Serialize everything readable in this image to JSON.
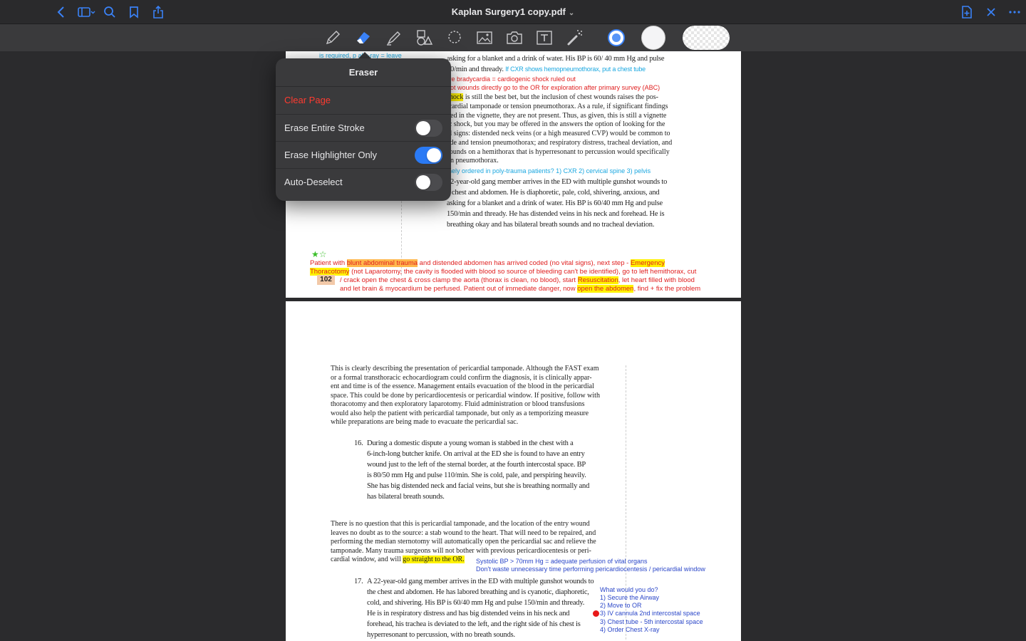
{
  "app": {
    "document_title": "Kaplan Surgery1 copy.pdf"
  },
  "colors": {
    "accent": "#3a82f7",
    "toggle_on": "#2a7af5",
    "danger": "#ff3b30",
    "pen_color_selected": "#3a82f7"
  },
  "topbar_icons": [
    "back-chevron-icon",
    "sidebar-icon",
    "search-icon",
    "bookmark-icon",
    "share-icon",
    "new-page-icon",
    "close-icon",
    "more-icon"
  ],
  "toolbar_tools": [
    "pen-icon",
    "eraser-icon",
    "highlighter-icon",
    "shapes-icon",
    "lasso-icon",
    "image-icon",
    "camera-icon",
    "text-box-icon",
    "laser-pointer-icon"
  ],
  "popover": {
    "title": "Eraser",
    "clear_page": "Clear Page",
    "rows": [
      {
        "label": "Erase Entire Stroke",
        "on": false
      },
      {
        "label": "Erase Highlighter Only",
        "on": true
      },
      {
        "label": "Auto-Deselect",
        "on": false
      }
    ]
  },
  "page1": {
    "left_fragment": "is required, p  al x-ray = leave",
    "lines_top": [
      "asking for a blanket and a drink of water. His BP is 60/ 40 mm Hg and pulse",
      "50/min and thready."
    ],
    "ann_cxr": "If CXR shows hemopneumothorax, put a chest tube",
    "ann_red1": "ive bradycardia = cardiogenic shock ruled out",
    "ann_red2": "hot wounds directly go to the OR for exploration after primary survey (ABC)",
    "shock_word": "shock",
    "shock_rest": " is still the best bet, but the inclusion of chest wounds raises the pos-",
    "body_lines": [
      "icardial tamponade or tension pneumothorax. As a rule, if significant findings",
      "ded in the vignette, they are not present. Thus, as given, this is still a vignette",
      "ic shock, but you may be offered in the answers the option of looking for the",
      "al signs: distended neck veins (or a high measured CVP) would be common to",
      "ade and tension pneumothorax; and respiratory distress, tracheal deviation, and",
      " sounds on a hemithorax that is hyperresonant to percussion would specifically",
      "on pneumothorax."
    ],
    "ann_routine": "inely ordered in poly-trauma patients?     1) CXR 2) cervical spine 3) pelvis",
    "q_lines": [
      "22-year-old gang member arrives in the ED with multiple gunshot wounds to",
      "e chest and abdomen. He is diaphoretic, pale, cold, shivering, anxious, and",
      "asking for a blanket and a drink of water. His BP is 60/40 mm Hg and pulse",
      "150/min and thready. He has distended veins in his neck and forehead. He is",
      "breathing okay and has bilateral breath sounds and no tracheal deviation."
    ],
    "stars": "★☆",
    "page_number": "102",
    "note": {
      "l1_a": "Patient with ",
      "l1_hl": "blunt abdominal trauma",
      "l1_b": " and distended abdomen has arrived coded (no vital signs), next step - ",
      "l1_hl2": "Emergency",
      "l2_hl": "Thoracotomy",
      "l2_b": " (not Laparotomy, the cavity is flooded with blood so source of bleeding can't be identified), go to left hemithorax, cut",
      "l3_a": "/ crack open the chest & cross clamp the aorta (thorax is clean, no blood), start ",
      "l3_hl": "Resuscitation",
      "l3_b": ", let heart filled with blood",
      "l4_a": "and let brain & myocardium be perfused. Patient out of immediate danger, now ",
      "l4_hl": "open the abdomen",
      "l4_b": ", find + fix the problem"
    }
  },
  "page2": {
    "para1": [
      "This is clearly describing the presentation of pericardial tamponade. Although the FAST exam",
      "or a formal transthoracic echocardiogram could confirm the diagnosis, it is clinically appar-",
      "ent and time is of the essence. Management entails evacuation of the blood in the pericardial",
      "space. This could be done by pericardiocentesis or pericardial window. If positive, follow with",
      "thoracotomy and then exploratory laparotomy. Fluid administration or blood transfusions",
      "would also help the patient with pericardial tamponade, but only as a temporizing measure",
      "while preparations are being made to evacuate the pericardial sac."
    ],
    "q16_num": "16.",
    "q16": [
      "During a domestic dispute a young woman is stabbed in the chest with a",
      "6-inch-long butcher knife. On arrival at the ED she is found to have an entry",
      "wound just to the left of the sternal border, at the fourth intercostal space. BP",
      "is 80/50 mm Hg and pulse 110/min. She is cold, pale, and perspiring heavily.",
      "She has big distended neck and facial veins, but she is breathing normally and",
      "has bilateral breath sounds."
    ],
    "para2": [
      "There is no question that this is pericardial tamponade, and the location of the entry wound",
      "leaves no doubt as to the source: a stab wound to the heart. That will need to be repaired, and",
      "performing the median sternotomy will automatically open the pericardial sac and relieve the",
      "tamponade. Many trauma surgeons will not bother with previous pericardiocentesis or peri-"
    ],
    "para2_last_a": "cardial window, and will ",
    "para2_last_hl": "go straight to the OR.",
    "ann_sys1": "Systolic BP > 70mm Hg = adequate perfusion of vital organs",
    "ann_sys2": "Don't waste unnecessary time performing pericardiocentesis / pericardial window",
    "q17_num": "17.",
    "q17": [
      "A 22-year-old gang member arrives in the ED with multiple gunshot wounds to",
      "the chest and abdomen. He has labored breathing and is cyanotic, diaphoretic,",
      "cold, and shivering. His BP is 60/40 mm Hg and pulse 150/min and thready.",
      "He is in respiratory distress and has big distended veins in his neck and",
      "forehead, his trachea is deviated to the left, and the right side of his chest is",
      "hyperresonant to percussion, with no breath sounds."
    ],
    "side_notes": [
      "What would you do?",
      "1) Secure the Airway",
      "2) Move to OR",
      "3) IV cannula 2nd intercostal space",
      "3) Chest tube - 5th intercostal space",
      "4) Order Chest X-ray"
    ]
  }
}
